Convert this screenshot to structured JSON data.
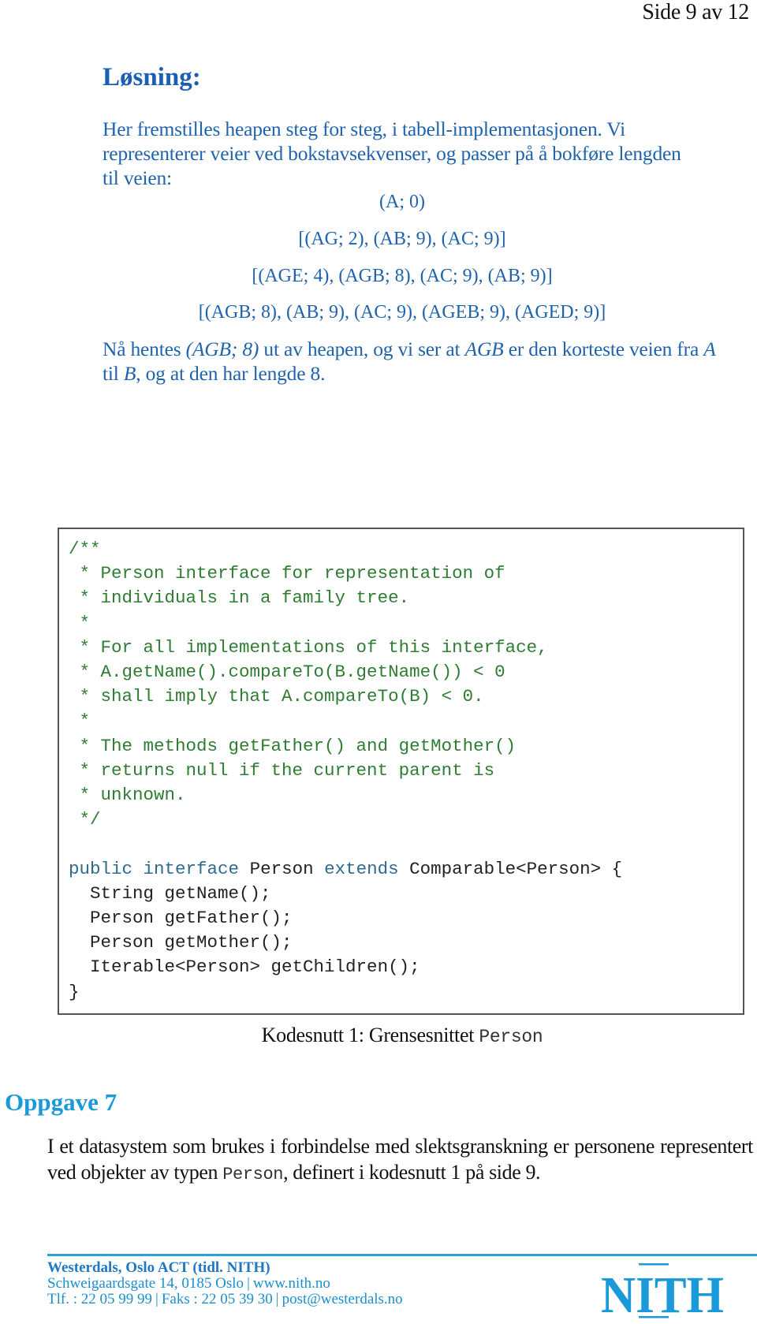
{
  "page_number": "Side 9 av 12",
  "solution": {
    "heading": "Løsning:",
    "intro": "Her fremstilles heapen steg for steg, i tabell-implementasjonen. Vi representerer veier ved bokstavsekvenser, og passer på å bokføre lengden til veien:",
    "heap_steps": [
      "(A; 0)",
      "[(AG; 2), (AB; 9), (AC; 9)]",
      "[(AGE; 4), (AGB; 8), (AC; 9), (AB; 9)]",
      "[(AGB; 8), (AB; 9), (AC; 9), (AGEB; 9), (AGED; 9)]"
    ],
    "conclusion": {
      "t1": "Nå hentes ",
      "m1": "(AGB; 8)",
      "t2": " ut av heapen, og vi ser at ",
      "m2": "AGB",
      "t3": " er den korteste veien fra ",
      "m3": "A",
      "t4": " til ",
      "m4": "B",
      "t5": ", og at den har lengde ",
      "m5": "8",
      "t6": "."
    }
  },
  "code_listing": {
    "comment_lines": [
      "/**",
      " * Person interface for representation of",
      " * individuals in a family tree.",
      " *",
      " * For all implementations of this interface,",
      " * A.getName().compareTo(B.getName()) < 0",
      " * shall imply that A.compareTo(B) < 0.",
      " *",
      " * The methods getFather() and getMother()",
      " * returns null if the current parent is",
      " * unknown.",
      " */"
    ],
    "declaration": {
      "kw1": "public",
      "kw2": "interface",
      "name": "Person",
      "kw3": "extends",
      "rest": "Comparable<Person> {"
    },
    "body_lines": [
      "  String getName();",
      "  Person getFather();",
      "  Person getMother();",
      "  Iterable<Person> getChildren();",
      "}"
    ],
    "caption_text": "Kodesnutt 1: Grensesnittet ",
    "caption_code": "Person"
  },
  "task": {
    "heading": "Oppgave 7",
    "text1": "I et datasystem som brukes i forbindelse med slektsgranskning er personene representert ved objekter av typen ",
    "code": "Person",
    "text2": ", definert i kodesnutt 1 på side 9."
  },
  "footer": {
    "organization": "Westerdals, Oslo ACT (tidl. NITH)",
    "address": "Schweigaardsgate 14, 0185 Oslo",
    "website": "www.nith.no",
    "phone": "Tlf. : 22 05 99 99",
    "fax": "Faks : 22 05 39 30",
    "email": "post@westerdals.no",
    "logo_text": "NITH",
    "brand_color": "#1a9ad9"
  }
}
